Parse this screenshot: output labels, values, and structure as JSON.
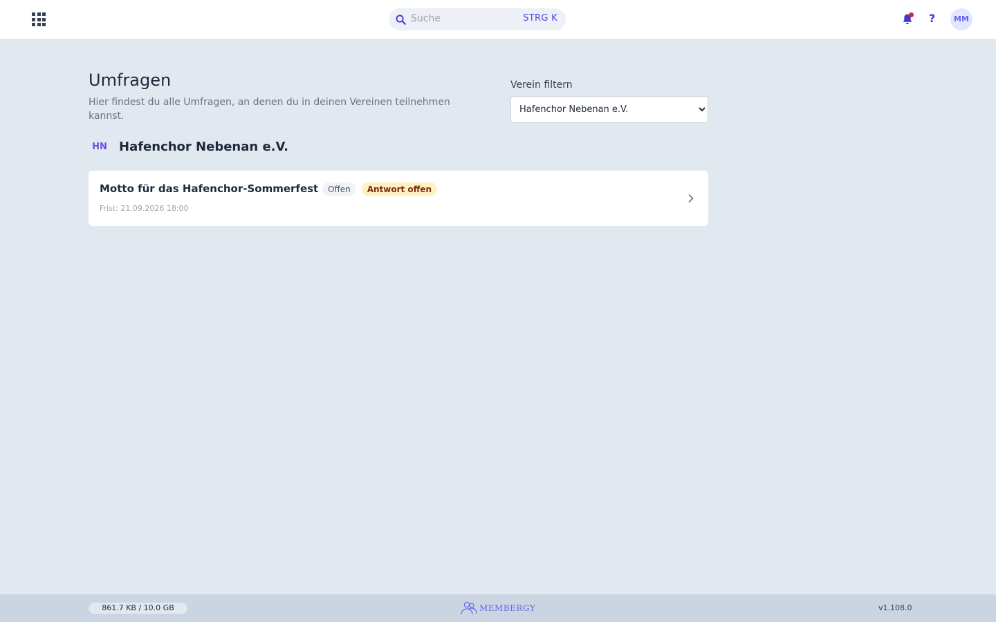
{
  "header": {
    "search_placeholder": "Suche",
    "search_shortcut": "STRG K",
    "help_label": "?",
    "avatar_initials": "MM",
    "notification_dot": true
  },
  "page": {
    "title": "Umfragen",
    "description": "Hier findest du alle Umfragen, an denen du in deinen Vereinen teilnehmen kannst."
  },
  "filter": {
    "label": "Verein filtern",
    "selected": "Hafenchor Nebenan e.V."
  },
  "club": {
    "initials": "HN",
    "name": "Hafenchor Nebenan e.V."
  },
  "polls": [
    {
      "title": "Motto für das Hafenchor-Sommerfest",
      "status": "Offen",
      "answer_status": "Antwort offen",
      "deadline": "Frist: 21.09.2026 18:00"
    }
  ],
  "footer": {
    "storage_text": "861.7 KB / 10.0 GB",
    "storage_used_fraction": 0.0001,
    "brand": "MEMBERGY",
    "version": "v1.108.0"
  },
  "colors": {
    "accent": "#4f46e5",
    "background": "#e2e8f0",
    "answer_badge_bg": "#fdf0c2",
    "notification_dot": "#dc2626"
  },
  "icons": [
    "app-grid-icon",
    "search-icon",
    "bell-icon",
    "chevron-right-icon",
    "membergy-logo-icon"
  ]
}
